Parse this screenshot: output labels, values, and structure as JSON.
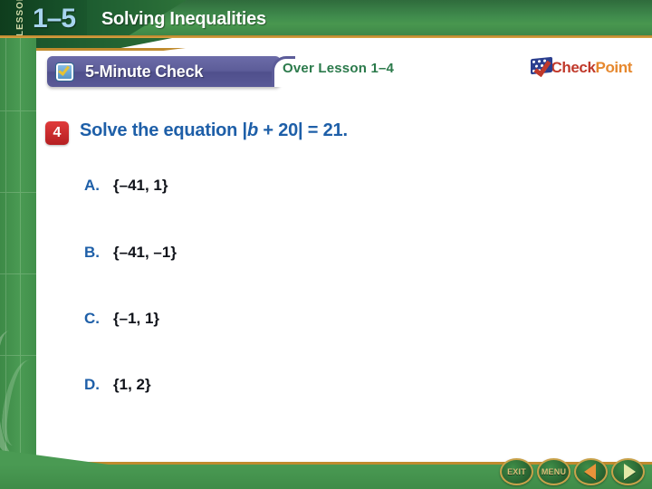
{
  "header": {
    "lesson_label": "LESSON",
    "lesson_number": "1–5",
    "title": "Solving Inequalities"
  },
  "banner": {
    "check_icon": "checkbox-checked-icon",
    "label": "5-Minute Check",
    "over_lesson": "Over Lesson 1–4"
  },
  "logo": {
    "icon": "checkpoint-flag-icon",
    "word_one": "Check",
    "word_two": "Point",
    "color_one": "#c0392b",
    "color_two": "#e6882e"
  },
  "question": {
    "number": "4",
    "badge_color": "#c0392b",
    "prompt_prefix": "Solve the equation |",
    "prompt_variable": "b",
    "prompt_suffix": " + 20| = 21.",
    "text_color": "#1e5fa8"
  },
  "options": [
    {
      "letter": "A.",
      "value": "{–41, 1}"
    },
    {
      "letter": "B.",
      "value": "{–41, –1}"
    },
    {
      "letter": "C.",
      "value": "{–1, 1}"
    },
    {
      "letter": "D.",
      "value": "{1, 2}"
    }
  ],
  "footer": {
    "exit_label": "EXIT",
    "menu_label": "MENU",
    "back_icon": "triangle-left-icon",
    "forward_icon": "triangle-right-icon",
    "back_color": "#e8933a",
    "forward_color": "#e4e9a8"
  }
}
